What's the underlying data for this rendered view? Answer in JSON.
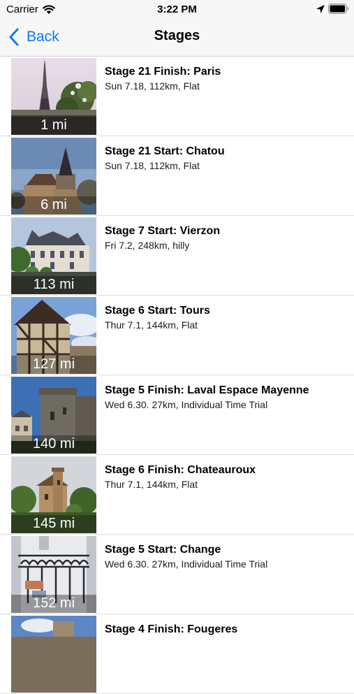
{
  "status": {
    "carrier": "Carrier",
    "time": "3:22 PM"
  },
  "nav": {
    "back_label": "Back",
    "title": "Stages"
  },
  "stages": [
    {
      "title": "Stage 21 Finish: Paris",
      "subtitle": "Sun 7.18, 112km, Flat",
      "distance": "1 mi",
      "thumbnail": "eiffel-tower-photo"
    },
    {
      "title": "Stage 21 Start: Chatou",
      "subtitle": "Sun 7.18, 112km, Flat",
      "distance": "6 mi",
      "thumbnail": "church-spire-photo"
    },
    {
      "title": "Stage 7 Start: Vierzon",
      "subtitle": "Fri 7.2, 248km, hilly",
      "distance": "113 mi",
      "thumbnail": "chateau-photo"
    },
    {
      "title": "Stage 6 Start: Tours",
      "subtitle": "Thur 7.1, 144km, Flat",
      "distance": "127 mi",
      "thumbnail": "timber-house-photo"
    },
    {
      "title": "Stage 5 Finish: Laval Espace Mayenne",
      "subtitle": "Wed 6.30. 27km, Individual Time Trial",
      "distance": "140 mi",
      "thumbnail": "castle-tower-photo"
    },
    {
      "title": "Stage 6 Finish: Chateauroux",
      "subtitle": "Thur 7.1, 144km, Flat",
      "distance": "145 mi",
      "thumbnail": "old-castle-photo"
    },
    {
      "title": "Stage 5 Start: Change",
      "subtitle": "Wed 6.30. 27km, Individual Time Trial",
      "distance": "152 mi",
      "thumbnail": "iron-gate-photo"
    },
    {
      "title": "Stage 4 Finish: Fougeres",
      "subtitle": "",
      "distance": "",
      "thumbnail": "city-photo"
    }
  ]
}
